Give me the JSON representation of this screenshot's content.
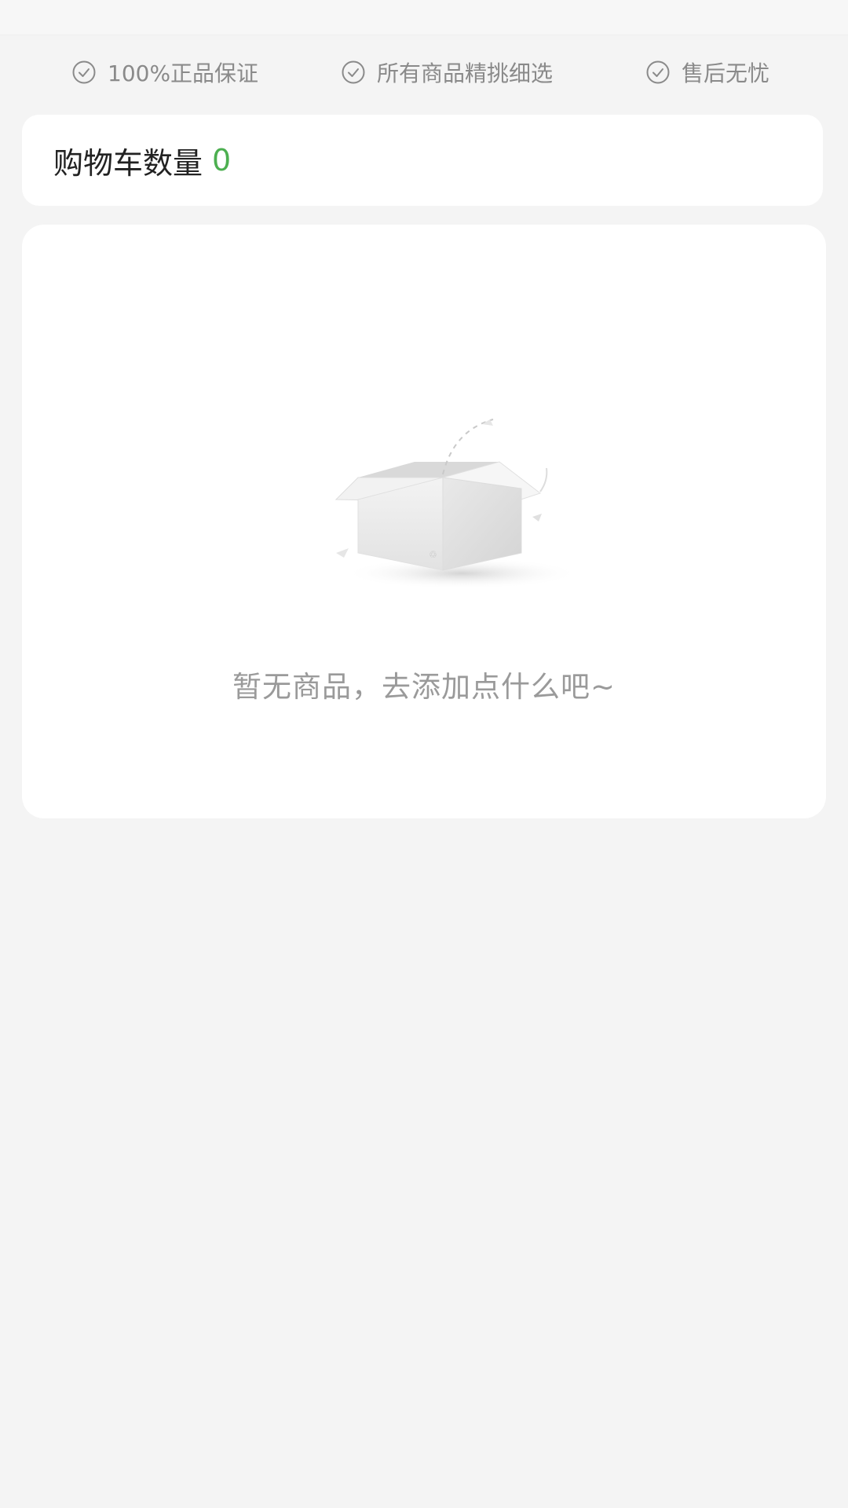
{
  "guarantees": [
    {
      "label": "100%正品保证",
      "icon": "check-circle-icon"
    },
    {
      "label": "所有商品精挑细选",
      "icon": "check-circle-icon"
    },
    {
      "label": "售后无忧",
      "icon": "check-circle-icon"
    }
  ],
  "cart": {
    "count_label": "购物车数量",
    "count_value": "0",
    "count_color": "#4caf50"
  },
  "empty_state": {
    "icon": "empty-box-icon",
    "message": "暂无商品，去添加点什么吧~"
  }
}
